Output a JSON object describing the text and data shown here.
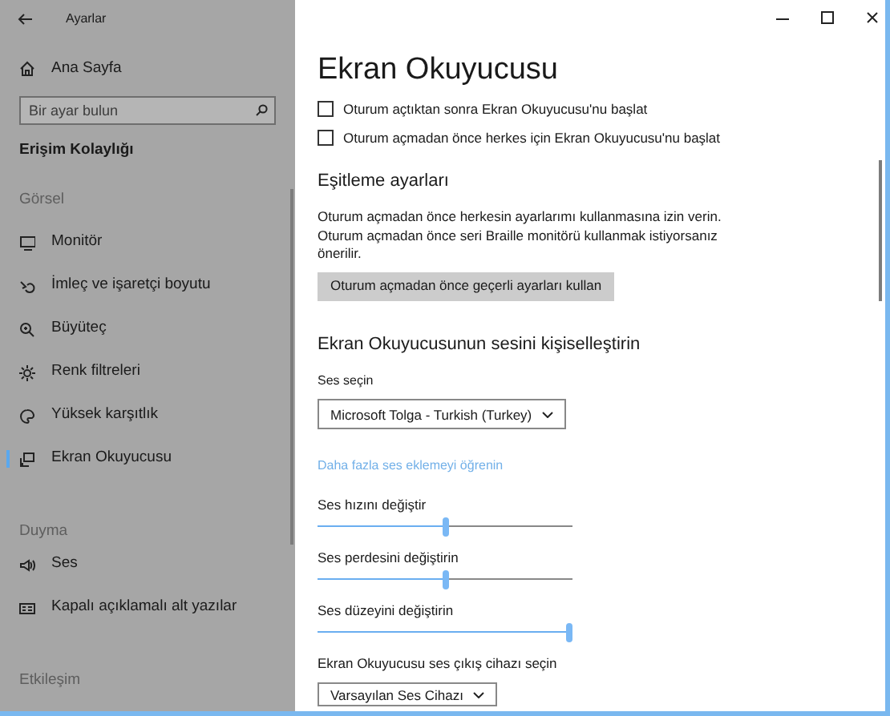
{
  "window": {
    "title": "Ayarlar"
  },
  "sidebar": {
    "home": "Ana Sayfa",
    "search": {
      "placeholder": "Bir ayar bulun"
    },
    "category": "Erişim Kolaylığı",
    "items": [
      {
        "kind": "heading",
        "label": "Görsel"
      },
      {
        "kind": "item",
        "label": "Monitör",
        "selected": false
      },
      {
        "kind": "item",
        "label": "İmleç ve işaretçi boyutu",
        "selected": false
      },
      {
        "kind": "item",
        "label": "Büyüteç",
        "selected": false
      },
      {
        "kind": "item",
        "label": "Renk filtreleri",
        "selected": false
      },
      {
        "kind": "item",
        "label": "Yüksek karşıtlık",
        "selected": false
      },
      {
        "kind": "item",
        "label": "Ekran Okuyucusu",
        "selected": true
      },
      {
        "kind": "heading",
        "label": "Duyma"
      },
      {
        "kind": "item",
        "label": "Ses",
        "selected": false
      },
      {
        "kind": "item",
        "label": "Kapalı açıklamalı alt yazılar",
        "selected": false
      },
      {
        "kind": "heading",
        "label": "Etkileşim"
      }
    ]
  },
  "page": {
    "title": "Ekran Okuyucusu",
    "checkboxes": [
      {
        "label": "Oturum açtıktan sonra Ekran Okuyucusu'nu başlat",
        "checked": false
      },
      {
        "label": "Oturum açmadan önce herkes için Ekran Okuyucusu'nu başlat",
        "checked": false
      }
    ],
    "sync": {
      "heading": "Eşitleme ayarları",
      "description": "Oturum açmadan önce herkesin ayarlarımı kullanmasına izin verin. Oturum açmadan önce seri Braille monitörü kullanmak istiyorsanız önerilir.",
      "button": "Oturum açmadan önce geçerli ayarları kullan"
    },
    "voice": {
      "heading": "Ekran Okuyucusunun sesini kişiselleştirin",
      "voice_label": "Ses seçin",
      "voice_value": "Microsoft Tolga - Turkish (Turkey)",
      "link": "Daha fazla ses eklemeyi öğrenin",
      "sliders": [
        {
          "label": "Ses hızını değiştir",
          "level": 0.5
        },
        {
          "label": "Ses perdesini değiştirin",
          "level": 0.5
        },
        {
          "label": "Ses düzeyini değiştirin",
          "level": 1
        }
      ],
      "device_label": "Ekran Okuyucusu ses çıkış cihazı seçin",
      "device_value": "Varsayılan Ses Cihazı"
    }
  }
}
